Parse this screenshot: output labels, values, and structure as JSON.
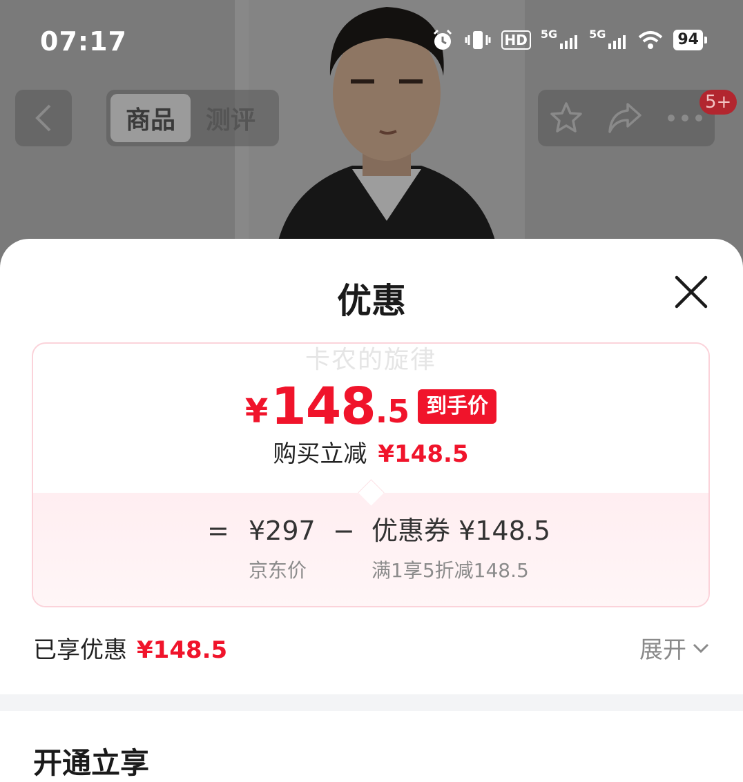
{
  "status_bar": {
    "time": "07:17",
    "hd_label": "HD",
    "net1": "5G",
    "net2": "5G",
    "battery": "94"
  },
  "top_nav": {
    "tabs": [
      {
        "label": "商品",
        "active": true
      },
      {
        "label": "测评",
        "active": false
      }
    ],
    "badge": "5+"
  },
  "sheet": {
    "title": "优惠",
    "watermark": "卡农的旋律",
    "final_price": {
      "currency": "¥",
      "integer": "148",
      "decimal": ".5",
      "tag": "到手价"
    },
    "instant_discount": {
      "label": "购买立减",
      "value": "¥148.5"
    },
    "breakdown": {
      "equals": "=",
      "jd_price": "¥297",
      "jd_price_caption": "京东价",
      "minus": "−",
      "coupon": "优惠券 ¥148.5",
      "coupon_caption": "满1享5折减148.5"
    },
    "enjoyed": {
      "label": "已享优惠",
      "value": "¥148.5"
    },
    "expand_label": "展开",
    "section_title": "开通立享"
  },
  "colors": {
    "accent_red": "#f0142b",
    "card_border": "#fbd3da"
  }
}
